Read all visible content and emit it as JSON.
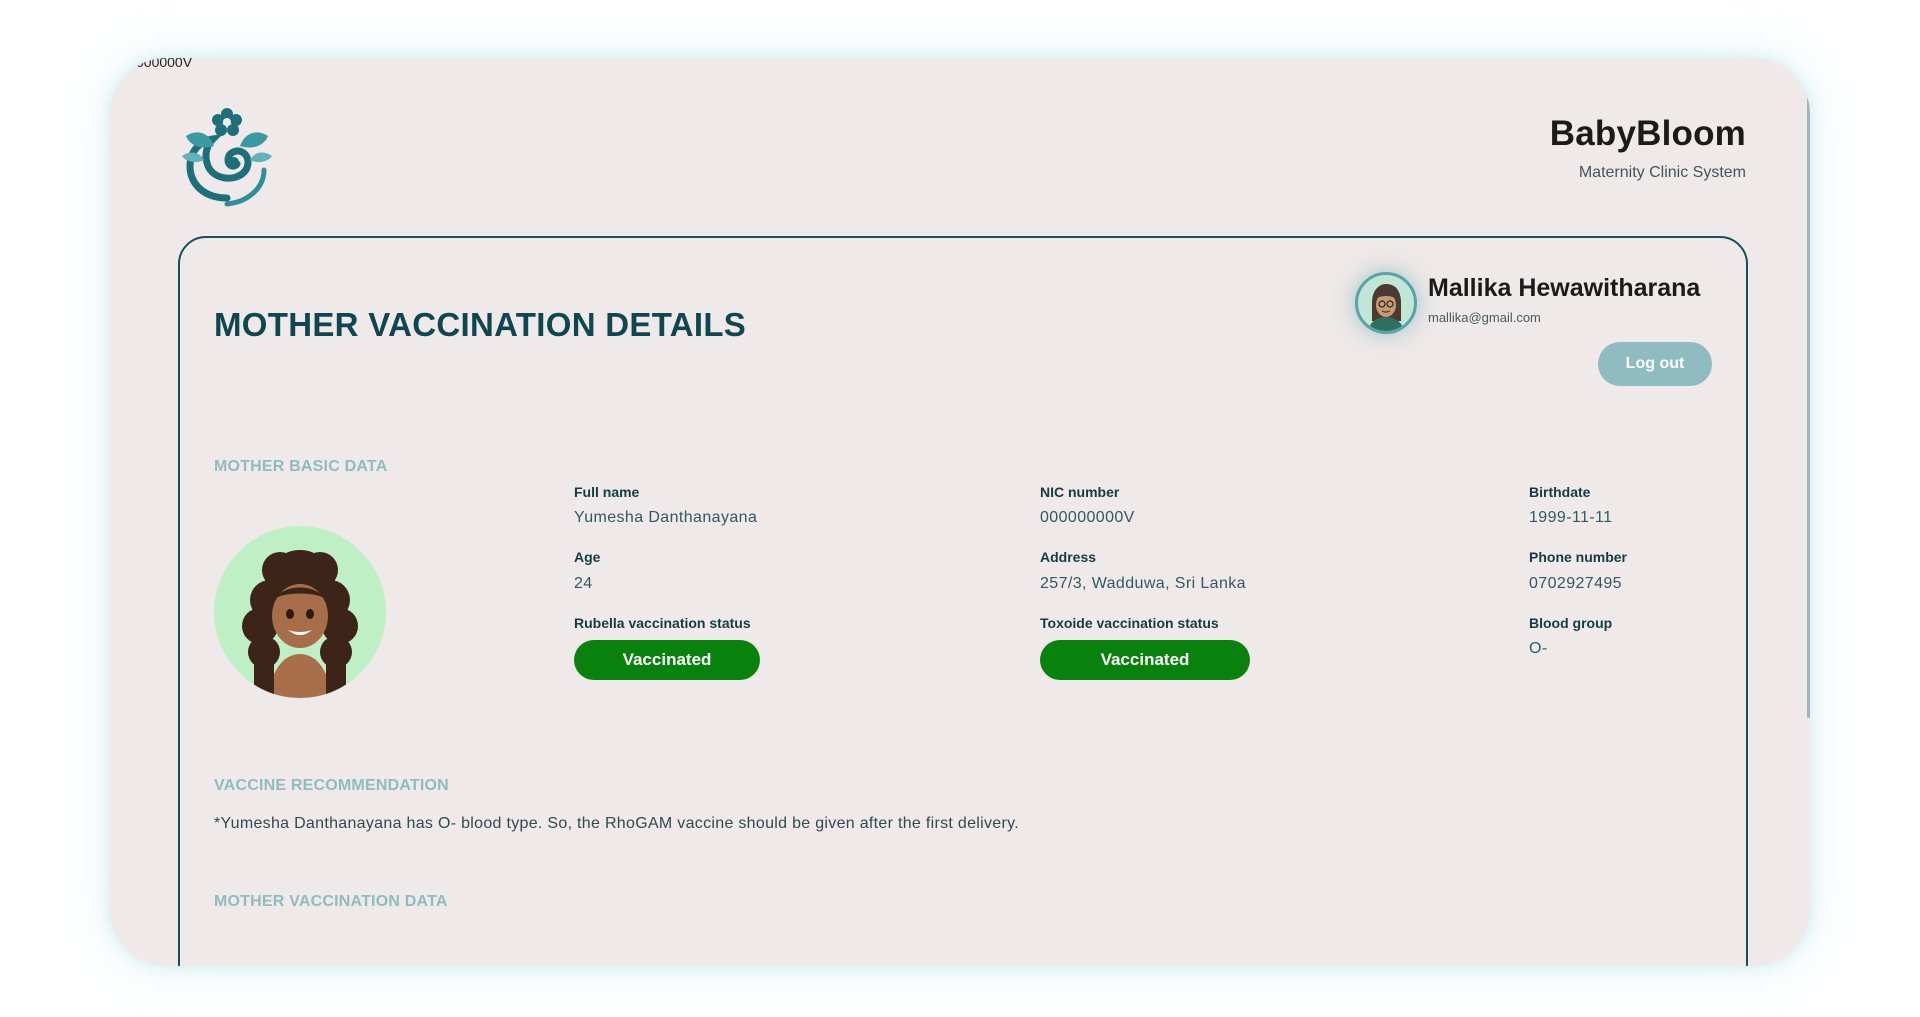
{
  "window": {
    "clipped_text": "000000V"
  },
  "brand": {
    "name": "BabyBloom",
    "subtitle": "Maternity Clinic System",
    "logo_icon": "flower-mother-baby-logo"
  },
  "header": {
    "page_title": "MOTHER VACCINATION DETAILS"
  },
  "user": {
    "name": "Mallika Hewawitharana",
    "email": "mallika@gmail.com",
    "logout_label": "Log out"
  },
  "sections": {
    "basic_data": "MOTHER BASIC DATA",
    "recommendation": "VACCINE RECOMMENDATION",
    "vaccination_data": "MOTHER VACCINATION DATA"
  },
  "mother": {
    "full_name_label": "Full name",
    "full_name": "Yumesha Danthanayana",
    "nic_label": "NIC number",
    "nic": "000000000V",
    "birthdate_label": "Birthdate",
    "birthdate": "1999-11-11",
    "age_label": "Age",
    "age": "24",
    "address_label": "Address",
    "address": "257/3, Wadduwa, Sri Lanka",
    "phone_label": "Phone number",
    "phone": "0702927495",
    "rubella_label": "Rubella vaccination status",
    "rubella_status": "Vaccinated",
    "toxoide_label": "Toxoide vaccination status",
    "toxoide_status": "Vaccinated",
    "blood_group_label": "Blood group",
    "blood_group": "O-"
  },
  "recommendation_text": "*Yumesha Danthanayana has O- blood type. So, the RhoGAM vaccine should be given after the first delivery.",
  "colors": {
    "accent": "#0f4751",
    "status_green": "#08820d",
    "muted_teal": "#8fbcc0",
    "background": "#efe9e9"
  }
}
